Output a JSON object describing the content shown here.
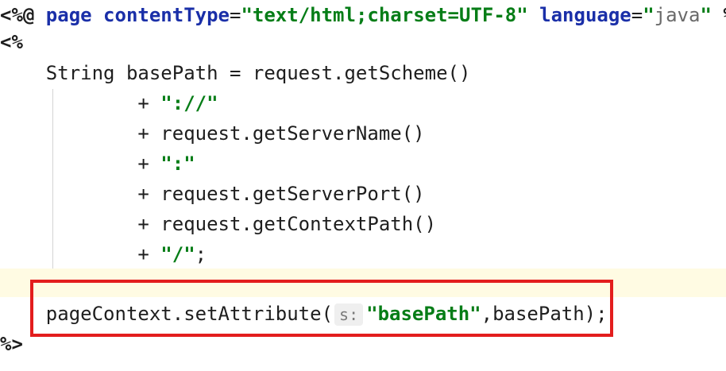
{
  "code": {
    "line1": {
      "open": "<%@ ",
      "page_kw": "page",
      "sp1": " ",
      "ct_attr": "contentType",
      "eq1": "=",
      "ct_val": "\"text/html;charset=UTF-8\"",
      "sp2": " ",
      "lang_attr": "language",
      "eq2": "=",
      "q_open": "\"",
      "lang_val": "java",
      "q_close": "\"",
      "close": " %>"
    },
    "line2": "<%",
    "line3": "    String basePath = request.getScheme()",
    "line4_prefix": "            + ",
    "line4_str": "\"://\"",
    "line5": "            + request.getServerName()",
    "line6_prefix": "            + ",
    "line6_str": "\":\"",
    "line7": "            + request.getServerPort()",
    "line8": "            + request.getContextPath()",
    "line9_prefix": "            + ",
    "line9_str": "\"/\"",
    "line9_suffix": ";",
    "line11": {
      "prefix": "    pageContext.setAttribute(",
      "hint": "s:",
      "arg": "\"basePath\"",
      "suffix": ",basePath);"
    },
    "line12": "%>"
  }
}
